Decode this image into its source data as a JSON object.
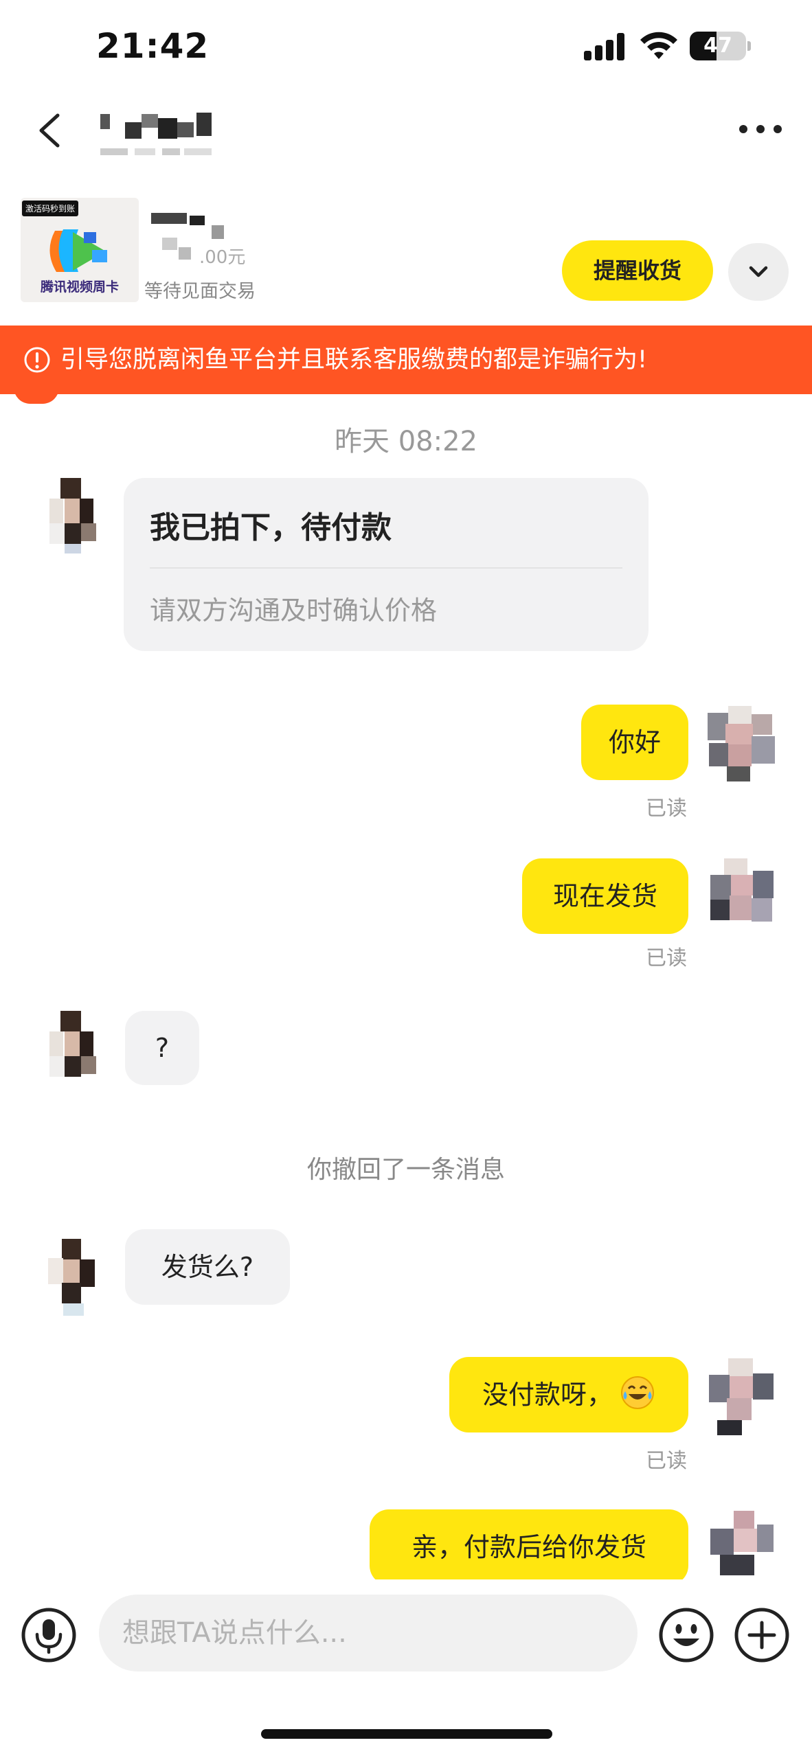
{
  "status_bar": {
    "time": "21:42",
    "battery_percent": "47",
    "battery_level": 0.47,
    "icons": [
      "cellular-signal-icon",
      "wifi-icon",
      "battery-icon"
    ]
  },
  "header": {
    "icons": [
      "back-chevron-icon",
      "more-dots-icon"
    ]
  },
  "product": {
    "thumb_tag": "激活码秒到账",
    "thumb_caption": "腾讯视频周卡",
    "price_fragment": ".00元",
    "status": "等待见面交易",
    "remind_button": "提醒收货",
    "expand_icon": "chevron-down-icon"
  },
  "warning": {
    "icon": "alert-circle-icon",
    "text": "引导您脱离闲鱼平台并且联系客服缴费的都是诈骗行为!"
  },
  "chat": {
    "timestamp": "昨天 08:22",
    "order_card": {
      "title": "我已拍下，待付款",
      "subtitle": "请双方沟通及时确认价格"
    },
    "messages": [
      {
        "side": "out",
        "text": "你好",
        "read": "已读"
      },
      {
        "side": "out",
        "text": "现在发货",
        "read": "已读"
      },
      {
        "side": "in",
        "text": "?"
      },
      {
        "side": "out",
        "text": "发货么?"
      },
      {
        "side": "out",
        "text": "没付款呀，",
        "emoji": "tears-of-joy-emoji",
        "read": "已读"
      },
      {
        "side": "out",
        "text": "亲，付款后给你发货"
      }
    ],
    "recall_notice": "你撤回了一条消息",
    "in_message_2": "发货么?"
  },
  "input_bar": {
    "placeholder": "想跟TA说点什么...",
    "icons": [
      "microphone-icon",
      "emoji-face-icon",
      "plus-icon"
    ]
  },
  "colors": {
    "accent_yellow": "#ffe60f",
    "warning_orange": "#ff5523",
    "incoming_bubble": "#f2f2f3"
  }
}
